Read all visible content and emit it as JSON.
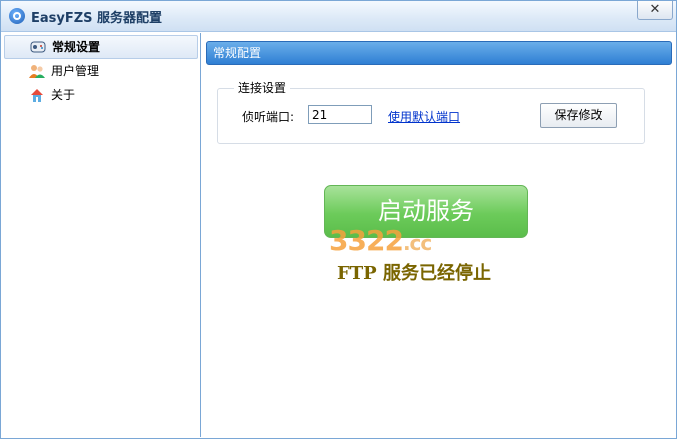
{
  "window": {
    "title": "EasyFZS 服务器配置",
    "close_glyph": "✕"
  },
  "sidebar": {
    "items": [
      {
        "label": "常规设置",
        "icon": "gamepad-settings-icon",
        "active": true
      },
      {
        "label": "用户管理",
        "icon": "users-icon",
        "active": false
      },
      {
        "label": "关于",
        "icon": "home-info-icon",
        "active": false
      }
    ]
  },
  "main": {
    "header": "常规配置",
    "group_title": "连接设置",
    "port_label": "侦听端口:",
    "port_value": "21",
    "default_port_link": "使用默认端口",
    "save_label": "保存修改",
    "start_label": "启动服务",
    "status_text": "FTP 服务已经停止",
    "watermark": "3322",
    "watermark_suffix": ".cc"
  },
  "colors": {
    "header_blue": "#2f7fd4",
    "start_green": "#6ccb5a",
    "status_olive": "#7a6500",
    "link_blue": "#0033cc"
  }
}
